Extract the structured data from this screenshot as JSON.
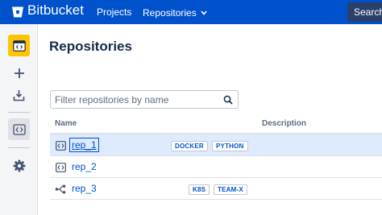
{
  "topbar": {
    "logo_text": "Bitbucket",
    "nav": {
      "projects_label": "Projects",
      "repositories_label": "Repositories"
    },
    "search_label": "Search"
  },
  "sidebar": {
    "items": [
      {
        "name": "repository-icon"
      },
      {
        "name": "create-icon"
      },
      {
        "name": "import-icon"
      },
      {
        "name": "code-icon"
      },
      {
        "name": "settings-icon"
      }
    ]
  },
  "main": {
    "title": "Repositories",
    "filter_placeholder": "Filter repositories by name",
    "columns": {
      "name": "Name",
      "description": "Description"
    },
    "repos": [
      {
        "name": "rep_1",
        "icon": "repository-icon",
        "tags": [
          "DOCKER",
          "PYTHON"
        ],
        "selected": true
      },
      {
        "name": "rep_2",
        "icon": "repository-icon",
        "tags": [],
        "selected": false
      },
      {
        "name": "rep_3",
        "icon": "fork-icon",
        "tags": [
          "K8S",
          "TEAM-X"
        ],
        "selected": false
      }
    ]
  },
  "colors": {
    "brand": "#0052cc",
    "sidebar_active": "#ffc400",
    "row_selected": "#deebff"
  }
}
